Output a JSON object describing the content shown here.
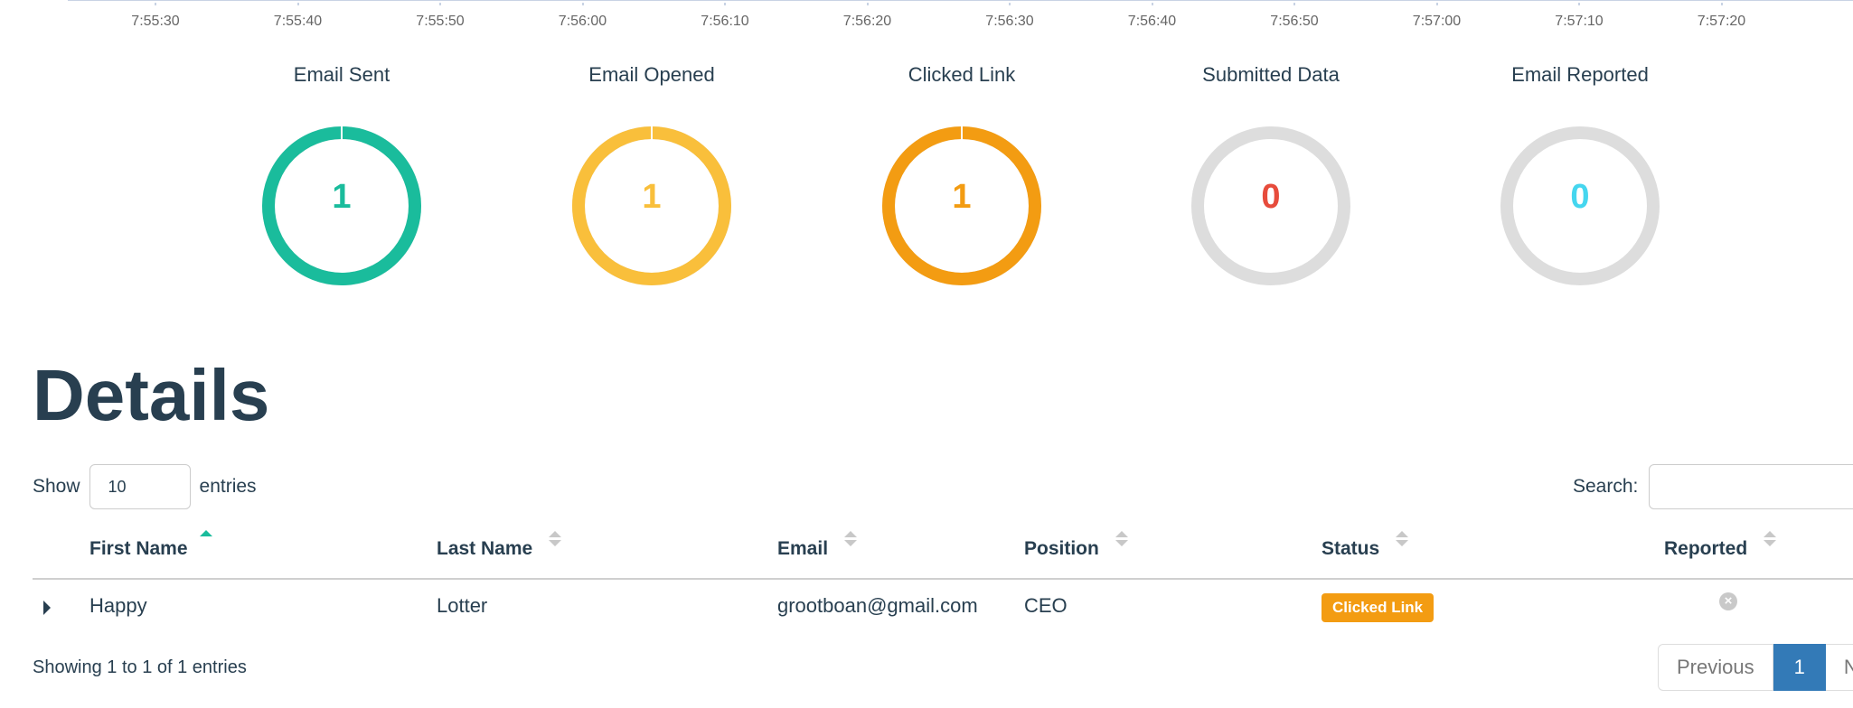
{
  "timeline": {
    "ticks": [
      "7:55:30",
      "7:55:40",
      "7:55:50",
      "7:56:00",
      "7:56:10",
      "7:56:20",
      "7:56:30",
      "7:56:40",
      "7:56:50",
      "7:57:00",
      "7:57:10",
      "7:57:20"
    ]
  },
  "stats": [
    {
      "title": "Email Sent",
      "value": "1",
      "fraction": 1,
      "color": "#1abc9c",
      "value_color": "#1abc9c"
    },
    {
      "title": "Email Opened",
      "value": "1",
      "fraction": 1,
      "color": "#f9bf3b",
      "value_color": "#f9bf3b"
    },
    {
      "title": "Clicked Link",
      "value": "1",
      "fraction": 1,
      "color": "#f39c12",
      "value_color": "#f39c12"
    },
    {
      "title": "Submitted Data",
      "value": "0",
      "fraction": 0,
      "color": "#dddddd",
      "value_color": "#e74c3c"
    },
    {
      "title": "Email Reported",
      "value": "0",
      "fraction": 0,
      "color": "#dddddd",
      "value_color": "#45d6ef"
    }
  ],
  "details": {
    "title": "Details",
    "show_label": "Show",
    "length_value": "10",
    "entries_label": "entries",
    "search_label": "Search:",
    "search_value": ""
  },
  "table": {
    "columns": [
      "First Name",
      "Last Name",
      "Email",
      "Position",
      "Status",
      "Reported"
    ],
    "rows": [
      {
        "first_name": "Happy",
        "last_name": "Lotter",
        "email": "grootboan@gmail.com",
        "position": "CEO",
        "status": "Clicked Link",
        "reported_icon": "close-circle-icon"
      }
    ],
    "info": "Showing 1 to 1 of 1 entries",
    "pagination": {
      "previous": "Previous",
      "current": "1",
      "next": "Next"
    }
  }
}
